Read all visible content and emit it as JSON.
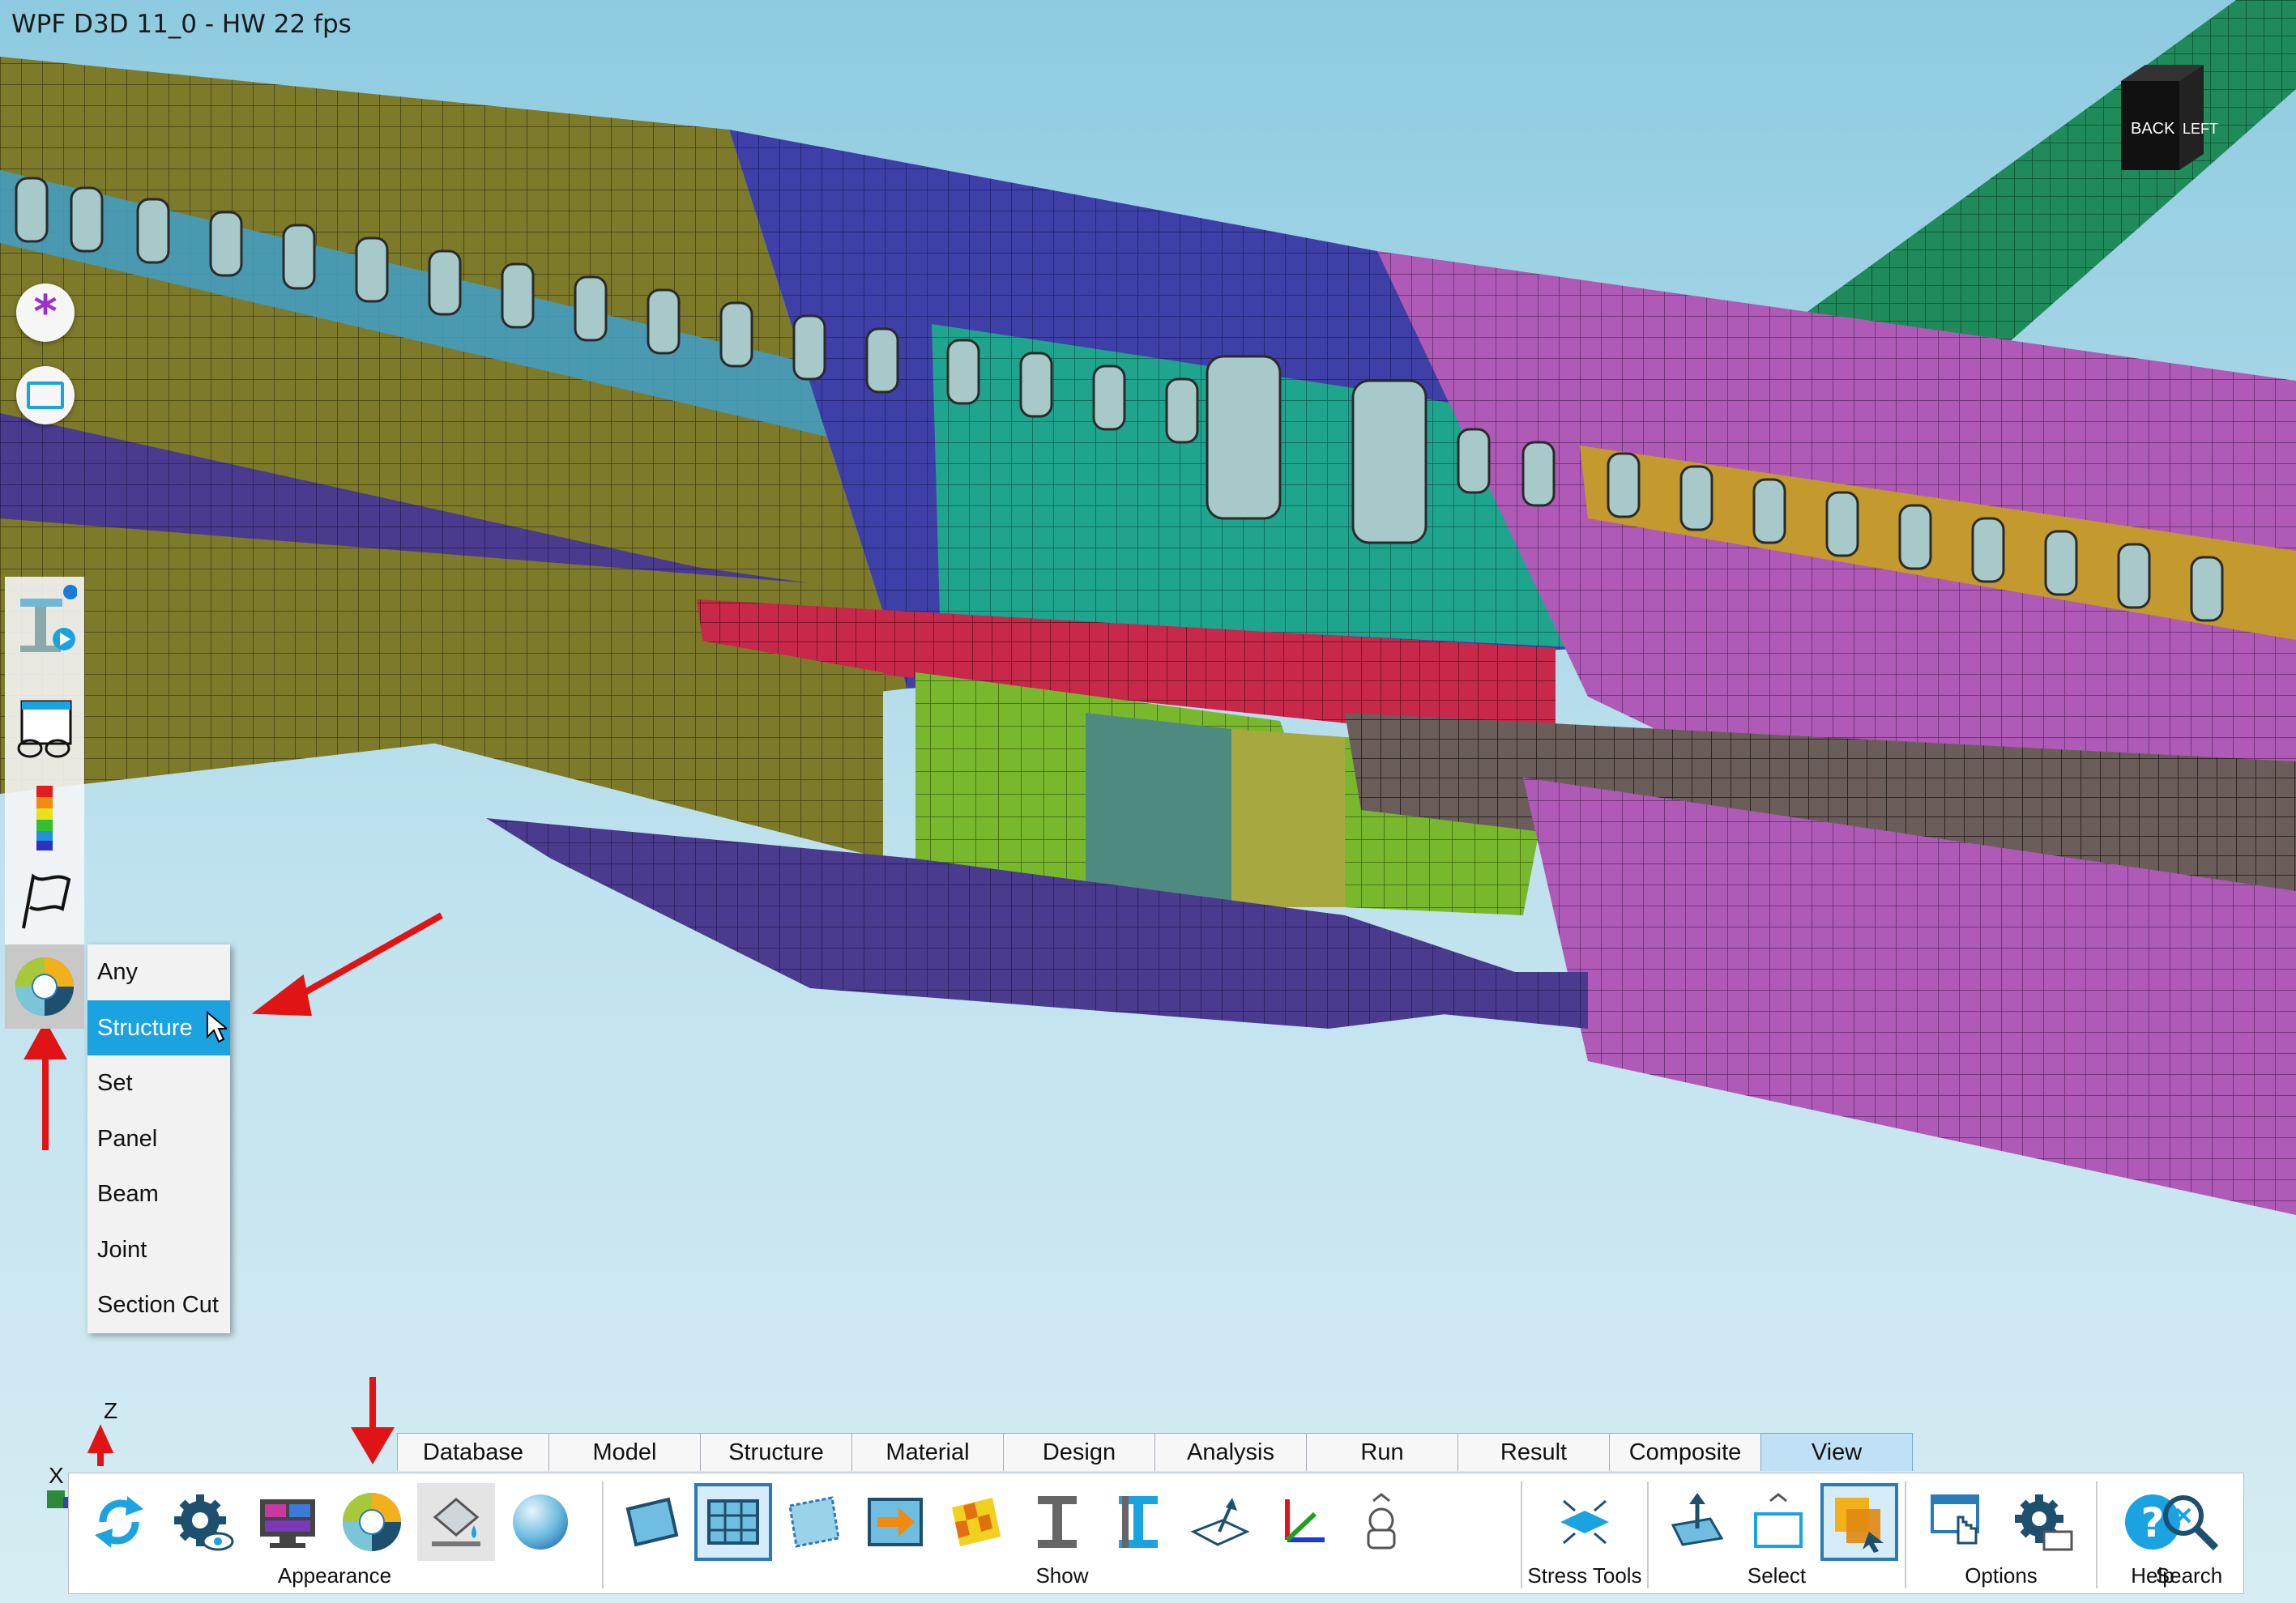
{
  "viewport": {
    "fps_label": "WPF D3D 11_0 - HW  22  fps"
  },
  "viewcube": {
    "back": "BACK",
    "left": "LEFT"
  },
  "left_buttons": [
    {
      "name": "select-all-icon"
    },
    {
      "name": "rectangle-select-icon"
    }
  ],
  "vertical_toolbar": [
    {
      "name": "beam-play-icon"
    },
    {
      "name": "glasses-window-icon"
    },
    {
      "name": "color-legend-icon"
    },
    {
      "name": "flag-icon"
    },
    {
      "name": "color-wheel-icon"
    }
  ],
  "color_by_menu": {
    "items": [
      "Any",
      "Structure",
      "Set",
      "Panel",
      "Beam",
      "Joint",
      "Section Cut"
    ],
    "selected": "Structure"
  },
  "axis": {
    "z": "Z",
    "x": "X"
  },
  "tabs": [
    "Database",
    "Model",
    "Structure",
    "Material",
    "Design",
    "Analysis",
    "Run",
    "Result",
    "Composite",
    "View"
  ],
  "active_tab": "View",
  "ribbon": {
    "groups": [
      {
        "label": "Appearance"
      },
      {
        "label": "Show"
      },
      {
        "label": "Stress Tools"
      },
      {
        "label": "Select"
      },
      {
        "label": "Options"
      },
      {
        "label": "Help"
      },
      {
        "label": "Search"
      }
    ]
  },
  "colors": {
    "sky": "#a9d9e8",
    "fuselage_olive": "#7d7a2a",
    "fuselage_blue": "#3f3fa8",
    "fuselage_teal": "#1fa58e",
    "fuselage_pink": "#b05ab8",
    "wing_green": "#1f8a5a",
    "menu_selected": "#1aa3e0",
    "tab_active": "#bfe0f5"
  }
}
